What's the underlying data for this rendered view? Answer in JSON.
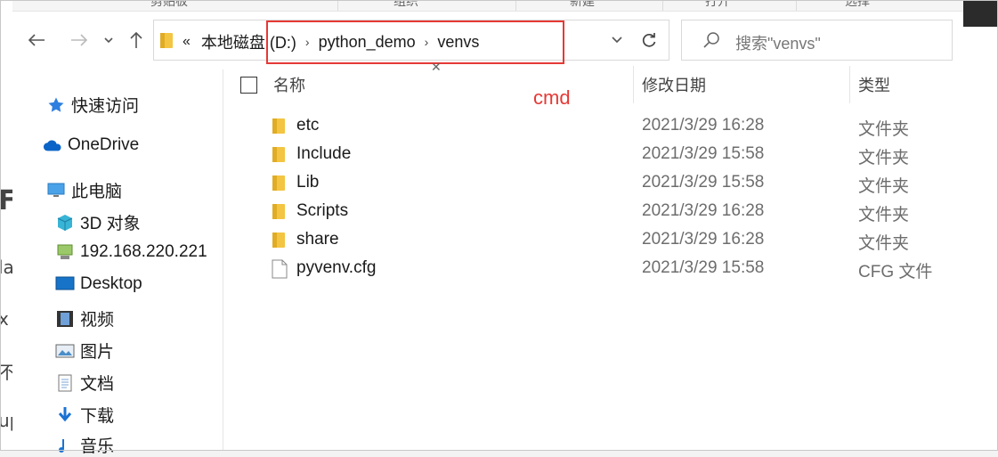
{
  "ribbon": {
    "labels": [
      "剪贴板",
      "组织",
      "新建",
      "打开",
      "选择"
    ]
  },
  "address": {
    "crumbs": [
      "本地磁盘 (D:)",
      "python_demo",
      "venvs"
    ],
    "overflow": "«"
  },
  "search": {
    "placeholder": "搜索\"venvs\""
  },
  "annotation": {
    "text": "cmd",
    "color": "#e53935"
  },
  "nav": {
    "items": [
      {
        "label": "快速访问",
        "icon": "star-icon"
      },
      {
        "label": "OneDrive",
        "icon": "cloud-icon"
      },
      {
        "label": "此电脑",
        "icon": "computer-icon"
      },
      {
        "label": "3D 对象",
        "icon": "cube-icon"
      },
      {
        "label": "192.168.220.221",
        "icon": "network-drive-icon"
      },
      {
        "label": "Desktop",
        "icon": "desktop-icon"
      },
      {
        "label": "视频",
        "icon": "video-icon"
      },
      {
        "label": "图片",
        "icon": "picture-icon"
      },
      {
        "label": "文档",
        "icon": "document-icon"
      },
      {
        "label": "下载",
        "icon": "download-icon"
      },
      {
        "label": "音乐",
        "icon": "music-icon"
      }
    ]
  },
  "columns": {
    "name": "名称",
    "date": "修改日期",
    "type": "类型"
  },
  "files": [
    {
      "name": "etc",
      "date": "2021/3/29 16:28",
      "type": "文件夹",
      "icon": "folder-icon"
    },
    {
      "name": "Include",
      "date": "2021/3/29 15:58",
      "type": "文件夹",
      "icon": "folder-icon"
    },
    {
      "name": "Lib",
      "date": "2021/3/29 15:58",
      "type": "文件夹",
      "icon": "folder-icon"
    },
    {
      "name": "Scripts",
      "date": "2021/3/29 16:28",
      "type": "文件夹",
      "icon": "folder-icon"
    },
    {
      "name": "share",
      "date": "2021/3/29 16:28",
      "type": "文件夹",
      "icon": "folder-icon"
    },
    {
      "name": "pyvenv.cfg",
      "date": "2021/3/29 15:58",
      "type": "CFG 文件",
      "icon": "file-icon"
    }
  ]
}
